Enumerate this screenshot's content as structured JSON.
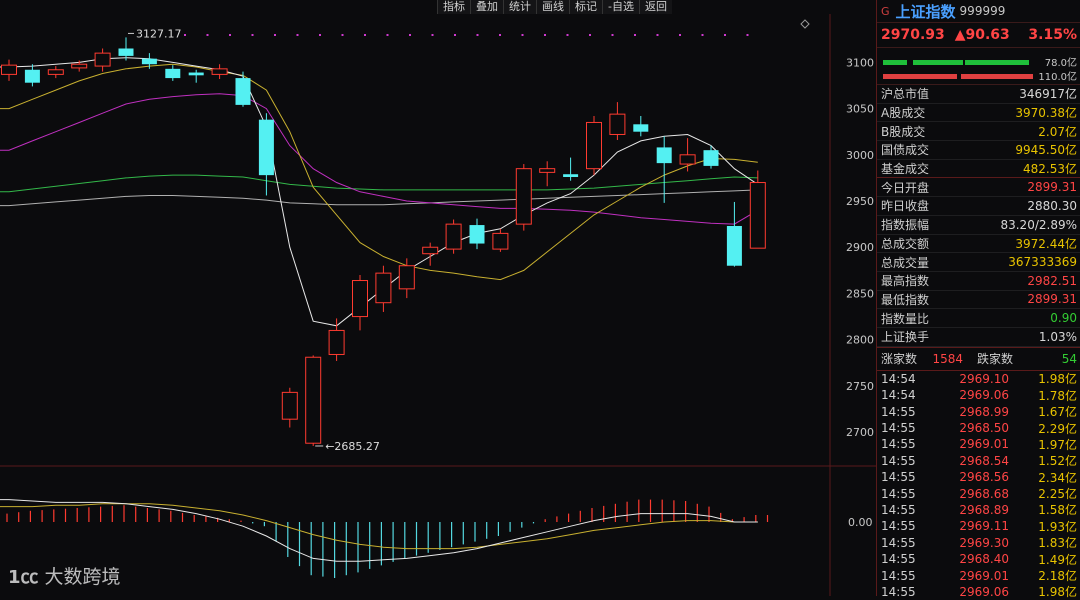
{
  "toolbar": [
    "指标",
    "叠加",
    "统计",
    "画线",
    "标记",
    "-自选",
    "返回"
  ],
  "watermark": {
    "logo": "☯",
    "text": "大数跨境"
  },
  "chart_data": {
    "type": "candlestick",
    "ylabels": [
      "3100",
      "3050",
      "3000",
      "2950",
      "2900",
      "2850",
      "2800",
      "2750",
      "2700"
    ],
    "yticks": [
      3100,
      3050,
      3000,
      2950,
      2900,
      2850,
      2800,
      2750,
      2700
    ],
    "ylim": [
      2672,
      3148
    ],
    "high_label": "3127.17",
    "low_label": "2685.27",
    "macd_zero_label": "0.00",
    "up_color": "#ff3b30",
    "down_color": "#54f0f2",
    "candles": [
      {
        "o": 3087,
        "c": 3097,
        "h": 3103,
        "l": 3080
      },
      {
        "o": 3092,
        "c": 3078,
        "h": 3098,
        "l": 3074
      },
      {
        "o": 3087,
        "c": 3092,
        "h": 3096,
        "l": 3083
      },
      {
        "o": 3094,
        "c": 3098,
        "h": 3102,
        "l": 3090
      },
      {
        "o": 3096,
        "c": 3110,
        "h": 3115,
        "l": 3090
      },
      {
        "o": 3115,
        "c": 3107,
        "h": 3127,
        "l": 3102
      },
      {
        "o": 3104,
        "c": 3098,
        "h": 3110,
        "l": 3093
      },
      {
        "o": 3093,
        "c": 3083,
        "h": 3097,
        "l": 3080
      },
      {
        "o": 3089,
        "c": 3086,
        "h": 3092,
        "l": 3078
      },
      {
        "o": 3087,
        "c": 3093,
        "h": 3098,
        "l": 3082
      },
      {
        "o": 3083,
        "c": 3054,
        "h": 3090,
        "l": 3052
      },
      {
        "o": 3038,
        "c": 2978,
        "h": 3045,
        "l": 2956
      },
      {
        "o": 2714,
        "c": 2743,
        "h": 2748,
        "l": 2705
      },
      {
        "o": 2688,
        "c": 2781,
        "h": 2783,
        "l": 2685
      },
      {
        "o": 2784,
        "c": 2810,
        "h": 2823,
        "l": 2777
      },
      {
        "o": 2825,
        "c": 2864,
        "h": 2870,
        "l": 2810
      },
      {
        "o": 2840,
        "c": 2872,
        "h": 2880,
        "l": 2830
      },
      {
        "o": 2855,
        "c": 2880,
        "h": 2888,
        "l": 2845
      },
      {
        "o": 2893,
        "c": 2900,
        "h": 2905,
        "l": 2880
      },
      {
        "o": 2898,
        "c": 2925,
        "h": 2930,
        "l": 2893
      },
      {
        "o": 2924,
        "c": 2904,
        "h": 2931,
        "l": 2898
      },
      {
        "o": 2898,
        "c": 2915,
        "h": 2920,
        "l": 2895
      },
      {
        "o": 2925,
        "c": 2985,
        "h": 2990,
        "l": 2918
      },
      {
        "o": 2981,
        "c": 2985,
        "h": 2993,
        "l": 2966
      },
      {
        "o": 2979,
        "c": 2976,
        "h": 2997,
        "l": 2972
      },
      {
        "o": 2985,
        "c": 3035,
        "h": 3042,
        "l": 2978
      },
      {
        "o": 3022,
        "c": 3044,
        "h": 3057,
        "l": 3016
      },
      {
        "o": 3033,
        "c": 3025,
        "h": 3042,
        "l": 3020
      },
      {
        "o": 3008,
        "c": 2991,
        "h": 3020,
        "l": 2948
      },
      {
        "o": 2990,
        "c": 3000,
        "h": 3018,
        "l": 2982
      },
      {
        "o": 3005,
        "c": 2988,
        "h": 3010,
        "l": 2985
      },
      {
        "o": 2923,
        "c": 2880,
        "h": 2949,
        "l": 2879
      },
      {
        "o": 2899,
        "c": 2970,
        "h": 2983,
        "l": 2899
      }
    ],
    "ma_white": [
      3095,
      3096,
      3098,
      3100,
      3104,
      3105,
      3104,
      3100,
      3096,
      3092,
      3085,
      3030,
      2900,
      2820,
      2815,
      2835,
      2855,
      2875,
      2890,
      2905,
      2915,
      2920,
      2935,
      2948,
      2958,
      2978,
      3003,
      3015,
      3020,
      3022,
      3010,
      2985,
      2968
    ],
    "ma_yellow": [
      3050,
      3060,
      3070,
      3080,
      3088,
      3093,
      3096,
      3098,
      3095,
      3090,
      3086,
      3070,
      3025,
      2965,
      2935,
      2905,
      2890,
      2880,
      2875,
      2872,
      2868,
      2865,
      2875,
      2895,
      2915,
      2935,
      2950,
      2965,
      2978,
      2988,
      2996,
      2995,
      2992
    ],
    "ma_purple": [
      3005,
      3015,
      3025,
      3035,
      3045,
      3055,
      3060,
      3063,
      3065,
      3066,
      3064,
      3050,
      3010,
      2985,
      2970,
      2960,
      2955,
      2950,
      2948,
      2946,
      2944,
      2942,
      2942,
      2941,
      2940,
      2938,
      2935,
      2932,
      2930,
      2928,
      2926,
      2925,
      2940
    ],
    "ma_green": [
      2960,
      2963,
      2966,
      2969,
      2972,
      2975,
      2977,
      2978,
      2978,
      2977,
      2976,
      2972,
      2968,
      2966,
      2964,
      2963,
      2962,
      2962,
      2962,
      2962,
      2962,
      2962,
      2962,
      2962,
      2963,
      2964,
      2966,
      2968,
      2970,
      2972,
      2974,
      2976,
      2975
    ],
    "ma_gray": [
      2945,
      2947,
      2949,
      2951,
      2953,
      2955,
      2956,
      2956,
      2955,
      2954,
      2953,
      2951,
      2948,
      2947,
      2946,
      2946,
      2946,
      2947,
      2948,
      2949,
      2950,
      2951,
      2952,
      2953,
      2954,
      2955,
      2956,
      2957,
      2958,
      2959,
      2960,
      2961,
      2962
    ],
    "macd_hist": [
      0.6,
      0.8,
      0.9,
      1.0,
      1.1,
      1.2,
      1.0,
      0.8,
      0.5,
      0.3,
      0.1,
      -0.3,
      -2.5,
      -3.8,
      -4.0,
      -3.6,
      -3.1,
      -2.6,
      -2.2,
      -1.8,
      -1.4,
      -1.0,
      -0.4,
      0.2,
      0.6,
      1.0,
      1.3,
      1.6,
      1.6,
      1.5,
      1.1,
      0.2,
      0.5
    ],
    "macd_dif": [
      1.6,
      1.5,
      1.4,
      1.4,
      1.4,
      1.3,
      1.1,
      0.9,
      0.6,
      0.2,
      -0.3,
      -1.0,
      -1.9,
      -2.6,
      -2.8,
      -2.8,
      -2.7,
      -2.6,
      -2.4,
      -2.2,
      -1.9,
      -1.5,
      -1.1,
      -0.7,
      -0.3,
      0.1,
      0.4,
      0.6,
      0.6,
      0.6,
      0.4,
      0.0,
      0.0
    ],
    "macd_dea": [
      1.1,
      1.1,
      1.2,
      1.2,
      1.3,
      1.3,
      1.3,
      1.2,
      1.0,
      0.8,
      0.5,
      0.1,
      -0.4,
      -0.9,
      -1.3,
      -1.6,
      -1.8,
      -1.9,
      -1.9,
      -1.9,
      -1.8,
      -1.6,
      -1.4,
      -1.2,
      -0.9,
      -0.6,
      -0.4,
      -0.2,
      0.0,
      0.1,
      0.1,
      0.0,
      0.0
    ]
  },
  "panel": {
    "flag": "G",
    "name": "上证指数",
    "code": "999999",
    "price": "2970.93",
    "change": "▲90.63",
    "pct": "3.15%",
    "bar_top_value": "78.0亿",
    "bar_bottom_value": "110.0亿",
    "stats": [
      {
        "k": "沪总市值",
        "v": "346917亿",
        "c": "white"
      },
      {
        "k": "A股成交",
        "v": "3970.38亿",
        "c": "yellow"
      },
      {
        "k": "B股成交",
        "v": "2.07亿",
        "c": "yellow"
      },
      {
        "k": "国债成交",
        "v": "9945.50亿",
        "c": "yellow"
      },
      {
        "k": "基金成交",
        "v": "482.53亿",
        "c": "yellow"
      },
      {
        "k": "今日开盘",
        "v": "2899.31",
        "c": "red"
      },
      {
        "k": "昨日收盘",
        "v": "2880.30",
        "c": "white"
      },
      {
        "k": "指数振幅",
        "v": "83.20/2.89%",
        "c": "white"
      },
      {
        "k": "总成交额",
        "v": "3972.44亿",
        "c": "yellow"
      },
      {
        "k": "总成交量",
        "v": "367333369",
        "c": "yellow"
      },
      {
        "k": "最高指数",
        "v": "2982.51",
        "c": "red"
      },
      {
        "k": "最低指数",
        "v": "2899.31",
        "c": "red"
      },
      {
        "k": "指数量比",
        "v": "0.90",
        "c": "green"
      },
      {
        "k": "上证换手",
        "v": "1.03%",
        "c": "white"
      }
    ],
    "up_label": "涨家数",
    "up_count": "1584",
    "down_label": "跌家数",
    "down_count": "54",
    "ticks": [
      {
        "t": "14:54",
        "p": "2969.10",
        "v": "1.98亿"
      },
      {
        "t": "14:54",
        "p": "2969.06",
        "v": "1.78亿"
      },
      {
        "t": "14:55",
        "p": "2968.99",
        "v": "1.67亿"
      },
      {
        "t": "14:55",
        "p": "2968.50",
        "v": "2.29亿"
      },
      {
        "t": "14:55",
        "p": "2969.01",
        "v": "1.97亿"
      },
      {
        "t": "14:55",
        "p": "2968.54",
        "v": "1.52亿"
      },
      {
        "t": "14:55",
        "p": "2968.56",
        "v": "2.34亿"
      },
      {
        "t": "14:55",
        "p": "2968.68",
        "v": "2.25亿"
      },
      {
        "t": "14:55",
        "p": "2968.89",
        "v": "1.58亿"
      },
      {
        "t": "14:55",
        "p": "2969.11",
        "v": "1.93亿"
      },
      {
        "t": "14:55",
        "p": "2969.30",
        "v": "1.83亿"
      },
      {
        "t": "14:55",
        "p": "2968.40",
        "v": "1.49亿"
      },
      {
        "t": "14:55",
        "p": "2969.01",
        "v": "2.18亿"
      },
      {
        "t": "14:55",
        "p": "2969.06",
        "v": "1.98亿"
      }
    ]
  }
}
